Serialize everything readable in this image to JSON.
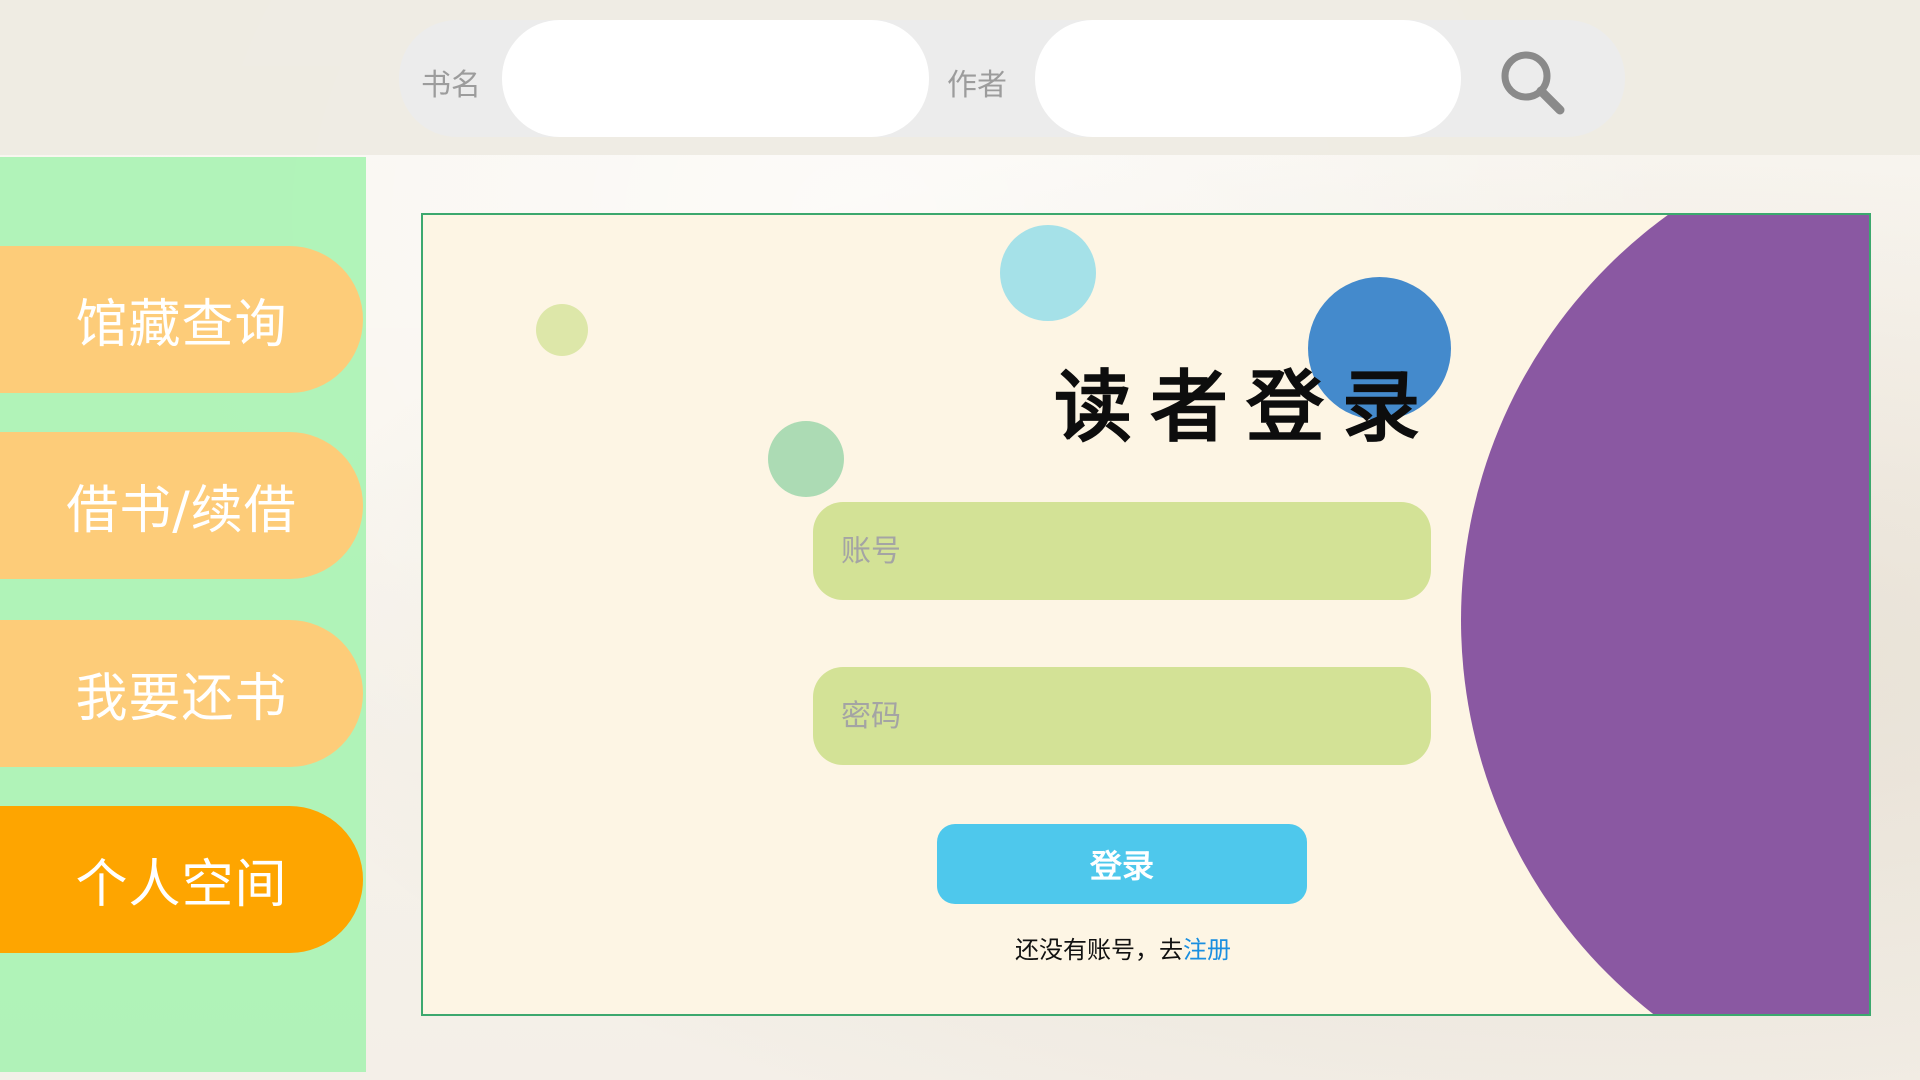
{
  "search": {
    "title_label": "书名",
    "title_value": "",
    "author_label": "作者",
    "author_value": "",
    "button_icon": "search-icon"
  },
  "sidebar": {
    "items": [
      {
        "label": "馆藏查询",
        "active": false
      },
      {
        "label": "借书/续借",
        "active": false
      },
      {
        "label": "我要还书",
        "active": false
      },
      {
        "label": "个人空间",
        "active": true
      }
    ]
  },
  "login": {
    "title": "读者登录",
    "account_placeholder": "账号",
    "password_placeholder": "密码",
    "submit_label": "登录",
    "register_prompt": "还没有账号，去",
    "register_link": "注册"
  },
  "colors": {
    "sidebar_bg": "#a6f2b0",
    "nav_item": "#fdcc79",
    "nav_item_active": "#fea500",
    "card_bg": "#fdf5e4",
    "purple_shape": "#8a58a2",
    "input_bg": "#d3e296",
    "login_button": "#4ec8ec",
    "link": "#1a8fe0"
  }
}
